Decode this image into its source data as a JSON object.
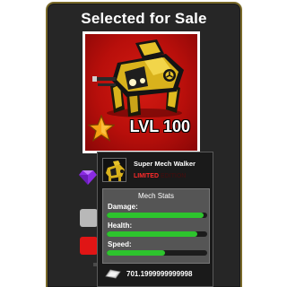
{
  "screen": {
    "title": "Selected for Sale"
  },
  "item": {
    "level_text": "LVL 100",
    "name": "Super Mech Walker",
    "rarity_visible": "LIMITED",
    "rarity_obscured": "EDITION",
    "rarity_color": "#c01414",
    "card_background": "#c0140d",
    "badge_icon": "star-icon",
    "art_icon": "mech-walker-icon"
  },
  "stats": {
    "header": "Mech Stats",
    "rows": [
      {
        "label": "Damage:",
        "fraction": 0.96
      },
      {
        "label": "Health:",
        "fraction": 0.9
      },
      {
        "label": "Speed:",
        "fraction": 0.58
      }
    ],
    "bar_color": "#2dc42d"
  },
  "price": {
    "value": "701.1999999999998",
    "icon": "silver-coin-icon"
  },
  "side_controls": {
    "gem_icon": "purple-gem-icon",
    "button_colors": [
      "#b8b8b8",
      "#e01515"
    ]
  }
}
